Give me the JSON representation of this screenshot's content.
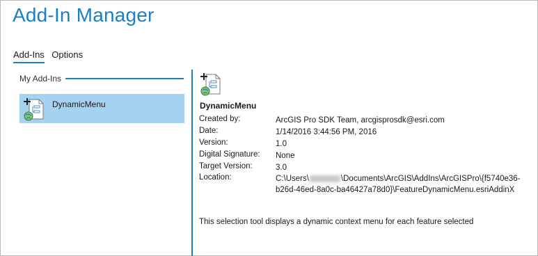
{
  "window": {
    "title": "Add-In Manager"
  },
  "tabs": [
    {
      "label": "Add-Ins",
      "active": true
    },
    {
      "label": "Options",
      "active": false
    }
  ],
  "left_pane": {
    "group_header": "My Add-Ins",
    "items": [
      {
        "name": "DynamicMenu",
        "icon": "addin-globe-icon",
        "selected": true
      }
    ]
  },
  "details": {
    "icon": "addin-globe-icon",
    "name": "DynamicMenu",
    "fields": {
      "created_by_label": "Created by:",
      "created_by_value": "ArcGIS Pro SDK Team, arcgisprosdk@esri.com",
      "date_label": "Date:",
      "date_value": "1/14/2016 3:44:56 PM, 2016",
      "version_label": "Version:",
      "version_value": "1.0",
      "digital_signature_label": "Digital Signature:",
      "digital_signature_value": "None",
      "target_version_label": "Target Version:",
      "target_version_value": "3.0",
      "location_label": "Location:",
      "location_prefix": "C:\\Users\\",
      "location_suffix_line1": "\\Documents\\ArcGIS\\AddIns\\ArcGISPro\\{f5740e36-",
      "location_line2": "b26d-46ed-8a0c-ba46427a78d0}\\FeatureDynamicMenu.esriAddinX"
    },
    "description": "This selection tool displays a dynamic context menu for each feature selected"
  },
  "colors": {
    "accent": "#1a7fc1",
    "selection": "#a5d2f1"
  }
}
